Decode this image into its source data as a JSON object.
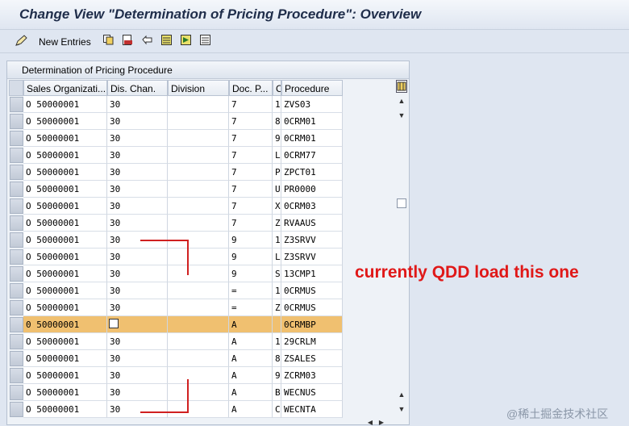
{
  "window": {
    "title": "Change View \"Determination of Pricing Procedure\": Overview"
  },
  "toolbar": {
    "new_entries_label": "New Entries",
    "icons": [
      "edit-pencil-icon",
      "copy-as-icon",
      "delete-icon",
      "undo-icon",
      "select-all-icon",
      "select-block-icon",
      "deselect-all-icon"
    ]
  },
  "table": {
    "title": "Determination of Pricing Procedure",
    "columns": [
      "Sales Organizati...",
      "Dis. Chan.",
      "Division",
      "Doc. P...",
      "C",
      "Procedure"
    ],
    "rows": [
      [
        "O 50000001",
        "30",
        "",
        "7",
        "1",
        "ZVS03"
      ],
      [
        "O 50000001",
        "30",
        "",
        "7",
        "8",
        "0CRM01"
      ],
      [
        "O 50000001",
        "30",
        "",
        "7",
        "9",
        "0CRM01"
      ],
      [
        "O 50000001",
        "30",
        "",
        "7",
        "L",
        "0CRM77"
      ],
      [
        "O 50000001",
        "30",
        "",
        "7",
        "P",
        "ZPCT01"
      ],
      [
        "O 50000001",
        "30",
        "",
        "7",
        "U",
        "PR0000"
      ],
      [
        "O 50000001",
        "30",
        "",
        "7",
        "X",
        "0CRM03"
      ],
      [
        "O 50000001",
        "30",
        "",
        "7",
        "Z",
        "RVAAUS"
      ],
      [
        "O 50000001",
        "30",
        "",
        "9",
        "1",
        "Z3SRVV"
      ],
      [
        "O 50000001",
        "30",
        "",
        "9",
        "L",
        "Z3SRVV"
      ],
      [
        "O 50000001",
        "30",
        "",
        "9",
        "S",
        "13CMP1"
      ],
      [
        "O 50000001",
        "30",
        "",
        "=",
        "1",
        "0CRMUS"
      ],
      [
        "O 50000001",
        "30",
        "",
        "=",
        "Z",
        "0CRMUS"
      ],
      [
        "0 50000001",
        "",
        "",
        "A",
        "",
        "0CRMBP"
      ],
      [
        "O 50000001",
        "30",
        "",
        "A",
        "1",
        "29CRLM"
      ],
      [
        "O 50000001",
        "30",
        "",
        "A",
        "8",
        "ZSALES"
      ],
      [
        "O 50000001",
        "30",
        "",
        "A",
        "9",
        "ZCRM03"
      ],
      [
        "O 50000001",
        "30",
        "",
        "A",
        "B",
        "WECNUS"
      ],
      [
        "O 50000001",
        "30",
        "",
        "A",
        "C",
        "WECNTA"
      ]
    ],
    "highlighted_row": 13
  },
  "annotation": {
    "text": "currently QDD load this one"
  },
  "watermark": {
    "text": "@稀土掘金技术社区"
  },
  "colors": {
    "highlight": "#f0c070",
    "annotation": "#e01818"
  }
}
